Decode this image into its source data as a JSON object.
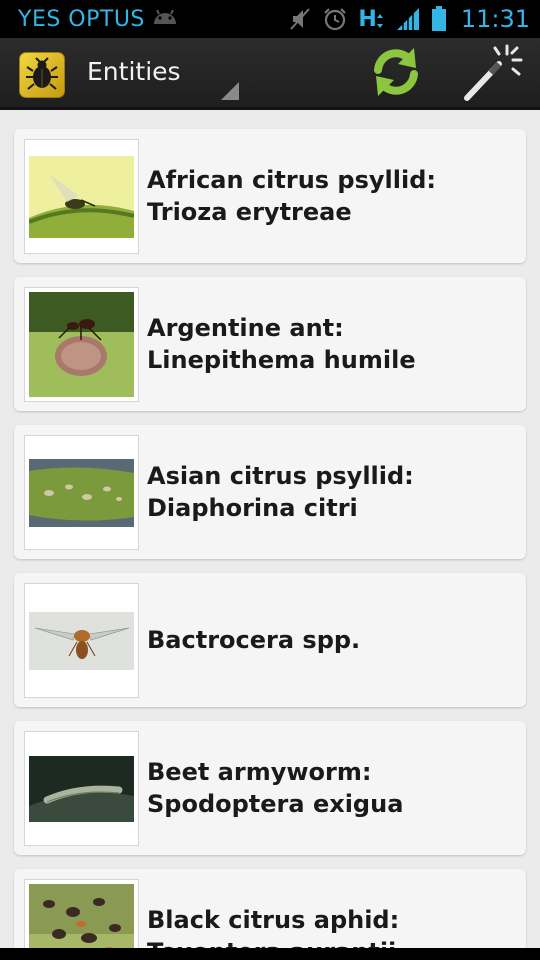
{
  "status_bar": {
    "carrier": "YES OPTUS",
    "network_label": "H",
    "time": "11:31",
    "icons": [
      "android-icon",
      "muted-icon",
      "alarm-icon",
      "hspa-icon",
      "signal-icon",
      "battery-icon"
    ]
  },
  "action_bar": {
    "title": "Entities",
    "icons": [
      "beetle-app-icon",
      "refresh-icon",
      "magic-wand-icon"
    ],
    "colors": {
      "refresh": "#8cc63f",
      "background": "#262626"
    }
  },
  "entities": [
    {
      "name": "African citrus psyllid: Trioza erytreae"
    },
    {
      "name": "Argentine ant: Linepithema humile"
    },
    {
      "name": "Asian citrus psyllid: Diaphorina citri"
    },
    {
      "name": "Bactrocera spp."
    },
    {
      "name": "Beet armyworm: Spodoptera exigua"
    },
    {
      "name": "Black citrus aphid: Toxoptera aurantii"
    }
  ],
  "colors": {
    "status_text": "#33b5e5",
    "list_background": "#ebebeb",
    "card_background": "#f5f5f5"
  }
}
